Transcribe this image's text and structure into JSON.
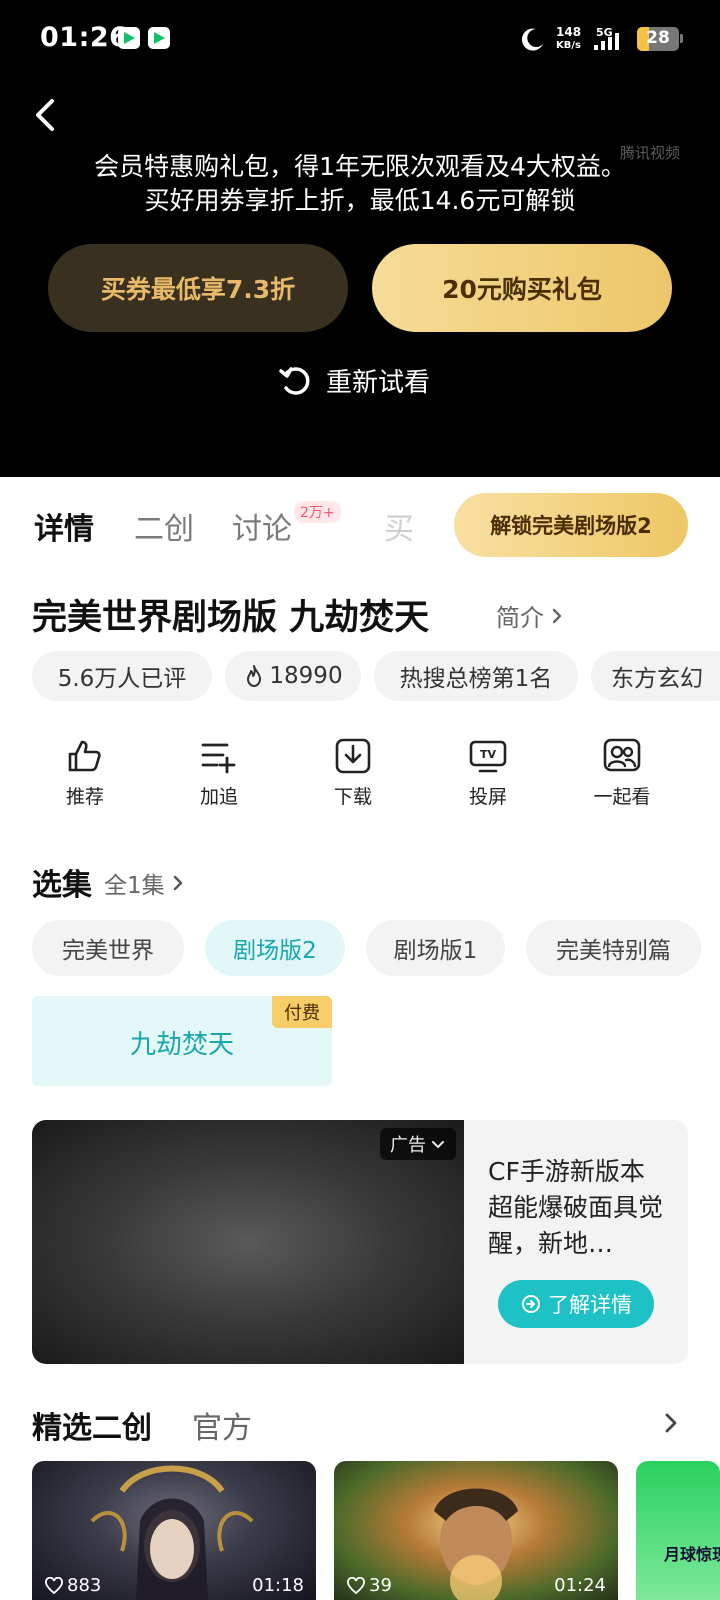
{
  "status_bar": {
    "time": "01:26",
    "speed_value": "148",
    "speed_unit": "KB/s",
    "network": "5G",
    "battery": "28"
  },
  "player": {
    "watermark": "腾讯视频",
    "promo_line1": "会员特惠购礼包，得1年无限次观看及4大权益。",
    "promo_line2": "买好用券享折上折，最低14.6元可解锁",
    "coupon_button": "买券最低享7.3折",
    "buy_button": "20元购买礼包",
    "retry_label": "重新试看"
  },
  "tabs": {
    "items": [
      "详情",
      "二创",
      "讨论",
      "买"
    ],
    "discuss_badge": "2万+",
    "unlock_button": "解锁完美剧场版2"
  },
  "show": {
    "title": "完美世界剧场版 九劫焚天",
    "intro_label": "简介",
    "chips": [
      "5.6万人已评",
      "18990",
      "热搜总榜第1名",
      "东方玄幻"
    ]
  },
  "actions": [
    "推荐",
    "加追",
    "下载",
    "投屏",
    "一起看"
  ],
  "episodes": {
    "title": "选集",
    "count_label": "全1集",
    "seasons": [
      "完美世界",
      "剧场版2",
      "剧场版1",
      "完美特别篇"
    ],
    "episode_name": "九劫焚天",
    "paid_badge": "付费"
  },
  "ad": {
    "tag": "广告",
    "text": "CF手游新版本超能爆破面具觉醒，新地…",
    "button": "了解详情"
  },
  "featured": {
    "title": "精选二创",
    "official": "官方",
    "thumbs": [
      {
        "likes": "883",
        "duration": "01:18"
      },
      {
        "likes": "39",
        "duration": "01:24"
      }
    ],
    "thumb3_text": "月球惊现宇"
  },
  "colors": {
    "accent_teal": "#17a7ad",
    "gold": "#eec765",
    "badge_pink": "#ff5570"
  }
}
